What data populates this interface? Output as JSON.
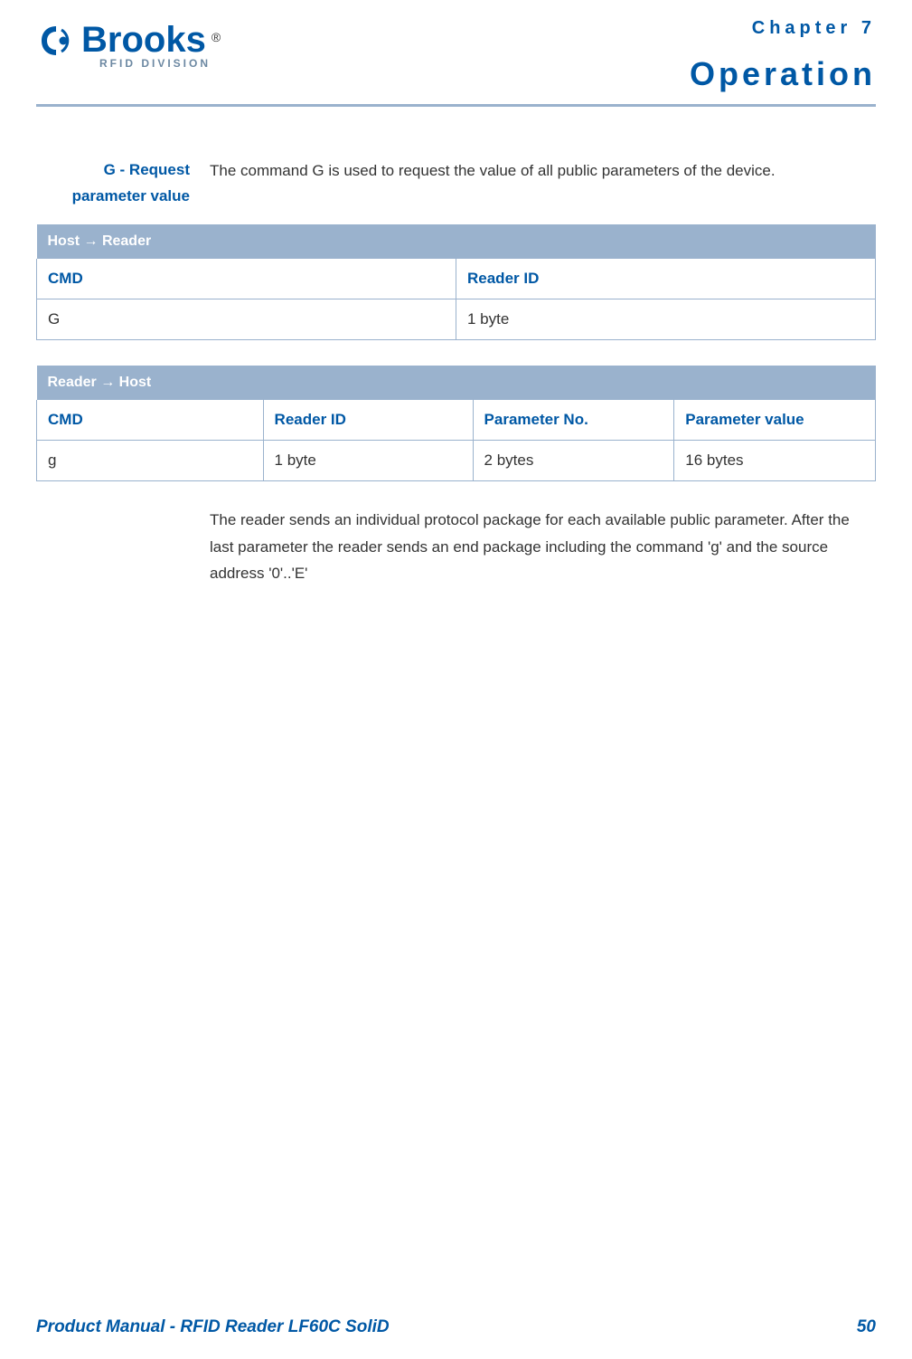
{
  "header": {
    "logo_text": "Brooks",
    "logo_sub": "RFID DIVISION",
    "chapter_label": "Chapter 7",
    "chapter_title": "Operation"
  },
  "section": {
    "label": "G - Request parameter value",
    "body": "The command G is used to request the value of all public parameters of the device."
  },
  "table1": {
    "title": "Host → Reader",
    "headers": [
      "CMD",
      "Reader ID"
    ],
    "row": [
      "G",
      "1 byte"
    ]
  },
  "table2": {
    "title": "Reader → Host",
    "headers": [
      "CMD",
      "Reader ID",
      "Parameter No.",
      "Parameter value"
    ],
    "row": [
      "g",
      "1 byte",
      "2 bytes",
      "16 bytes"
    ]
  },
  "note": "The reader sends an individual protocol package for each available public parameter. After the last parameter the reader sends an end package including the command 'g' and the source address '0'..'E'",
  "footer": {
    "left": "Product Manual - RFID Reader LF60C SoliD",
    "page": "50"
  }
}
